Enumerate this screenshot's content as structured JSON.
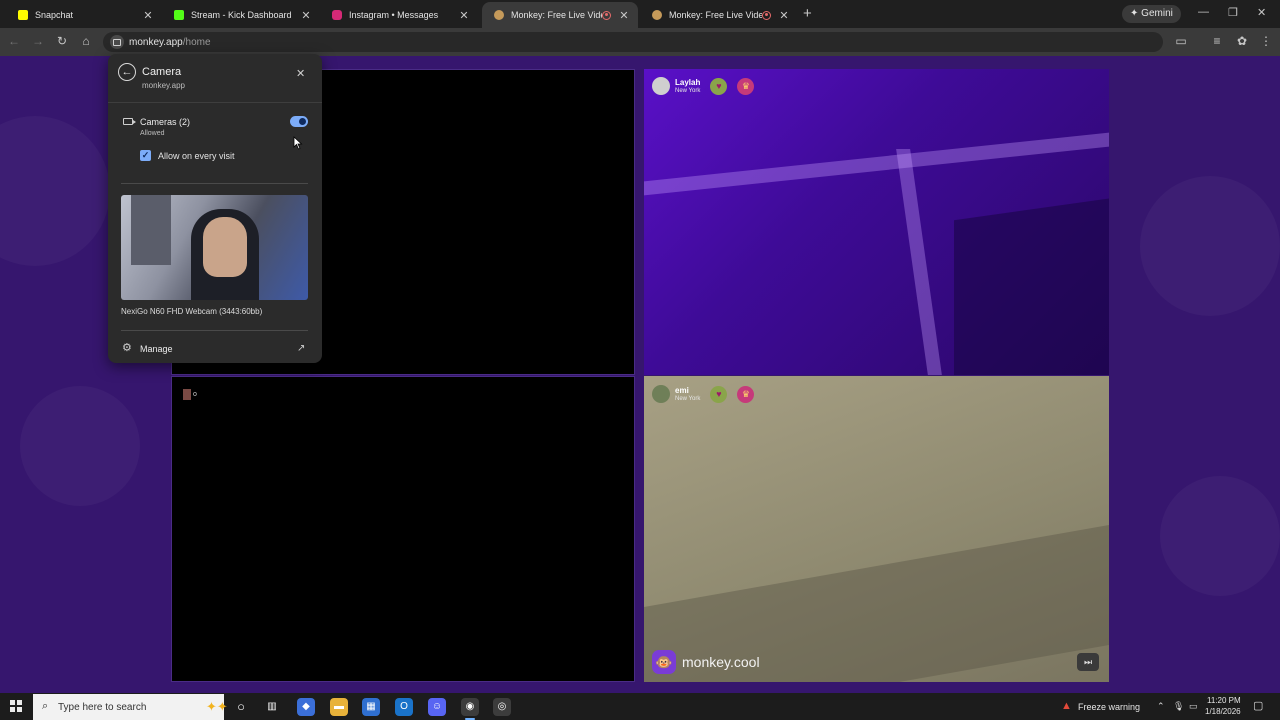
{
  "tabs": [
    {
      "title": "Snapchat",
      "favicon_color": "#fffc00"
    },
    {
      "title": "Stream - Kick Dashboard",
      "favicon_color": "#53fc18"
    },
    {
      "title": "Instagram • Messages",
      "favicon_color": "#d62976"
    },
    {
      "title": "Monkey: Free Live Video Ch",
      "favicon_color": "#c59a5a",
      "recording": true,
      "active": true
    },
    {
      "title": "Monkey: Free Live Video Ch",
      "favicon_color": "#c59a5a",
      "recording": true
    }
  ],
  "gemini_label": "Gemini",
  "address": {
    "domain": "monkey.app",
    "path": "/home"
  },
  "popup": {
    "title": "Camera",
    "subtitle": "monkey.app",
    "cameras_label": "Cameras (2)",
    "cameras_status": "Allowed",
    "toggle_on": true,
    "checkbox_label": "Allow on every visit",
    "checkbox_checked": true,
    "device_name": "NexiGo N60 FHD Webcam (3443:60bb)",
    "manage_label": "Manage"
  },
  "streams": [
    {
      "name": "Laylah",
      "location": "New York"
    },
    {
      "name": "emi",
      "location": "New York"
    }
  ],
  "brand": "monkey.cool",
  "taskbar": {
    "search_placeholder": "Type here to search",
    "weather": "Freeze warning",
    "time": "11:20 PM",
    "date": "1/18/2026"
  },
  "colors": {
    "page_bg": "#36166e",
    "accent": "#7cacf8",
    "brand": "#7a3cd6"
  }
}
